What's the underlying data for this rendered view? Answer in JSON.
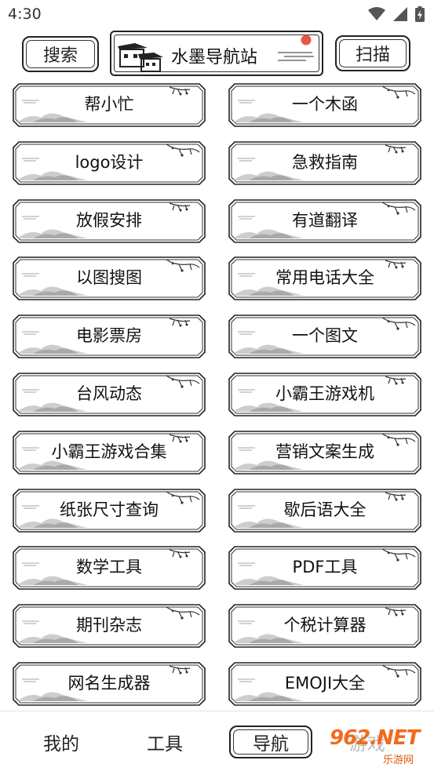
{
  "status": {
    "time": "4:30"
  },
  "header": {
    "search_label": "搜索",
    "title": "水墨导航站",
    "scan_label": "扫描"
  },
  "cards": [
    {
      "label": "帮小忙"
    },
    {
      "label": "一个木函"
    },
    {
      "label": "logo设计"
    },
    {
      "label": "急救指南"
    },
    {
      "label": "放假安排"
    },
    {
      "label": "有道翻译"
    },
    {
      "label": "以图搜图"
    },
    {
      "label": "常用电话大全"
    },
    {
      "label": "电影票房"
    },
    {
      "label": "一个图文"
    },
    {
      "label": "台风动态"
    },
    {
      "label": "小霸王游戏机"
    },
    {
      "label": "小霸王游戏合集"
    },
    {
      "label": "营销文案生成"
    },
    {
      "label": "纸张尺寸查询"
    },
    {
      "label": "歇后语大全"
    },
    {
      "label": "数学工具"
    },
    {
      "label": "PDF工具"
    },
    {
      "label": "期刊杂志"
    },
    {
      "label": "个税计算器"
    },
    {
      "label": "网名生成器"
    },
    {
      "label": "EMOJI大全"
    }
  ],
  "tabs": {
    "mine": "我的",
    "tools": "工具",
    "nav": "导航",
    "game": "游戏"
  },
  "watermark": {
    "brand": "962.NET",
    "sub": "乐游网"
  },
  "colors": {
    "ink": "#222222",
    "mountain": "#bcbcbc",
    "seal": "#e8564a",
    "watermark": "#f26a1b"
  }
}
